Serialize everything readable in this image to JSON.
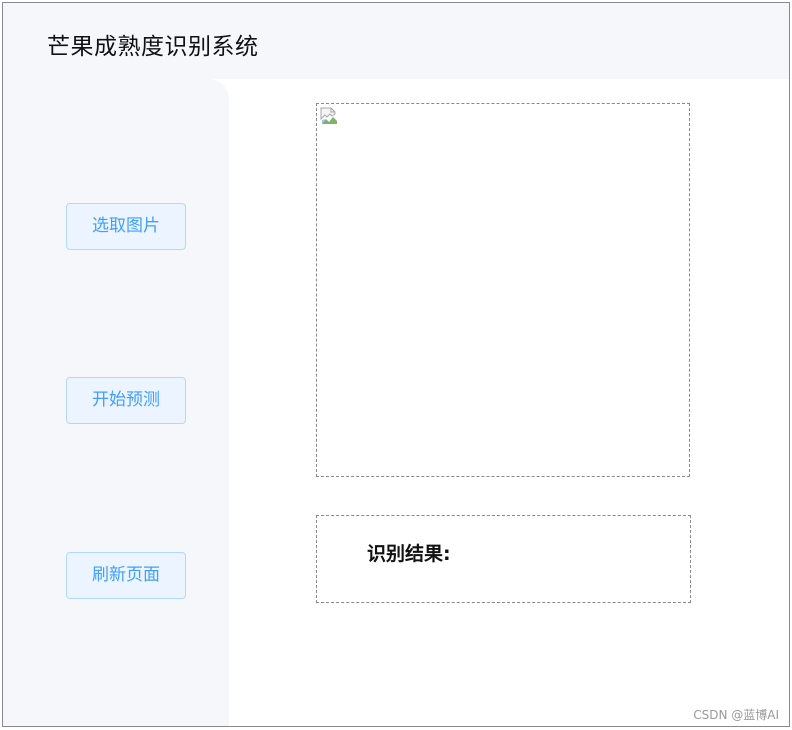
{
  "app": {
    "title": "芒果成熟度识别系统"
  },
  "sidebar": {
    "buttons": [
      {
        "label": "选取图片"
      },
      {
        "label": "开始预测"
      },
      {
        "label": "刷新页面"
      }
    ]
  },
  "main": {
    "image_placeholder": {
      "icon": "broken-image-icon"
    },
    "result": {
      "label": "识别结果:",
      "value": ""
    }
  },
  "watermark": "CSDN @蓝博AI",
  "colors": {
    "accent": "#409eff",
    "button_background": "#ecf5ff",
    "button_border": "#b3d8ff",
    "panel_background": "#f5f7fa",
    "dashed_border": "#8a8a8a"
  }
}
